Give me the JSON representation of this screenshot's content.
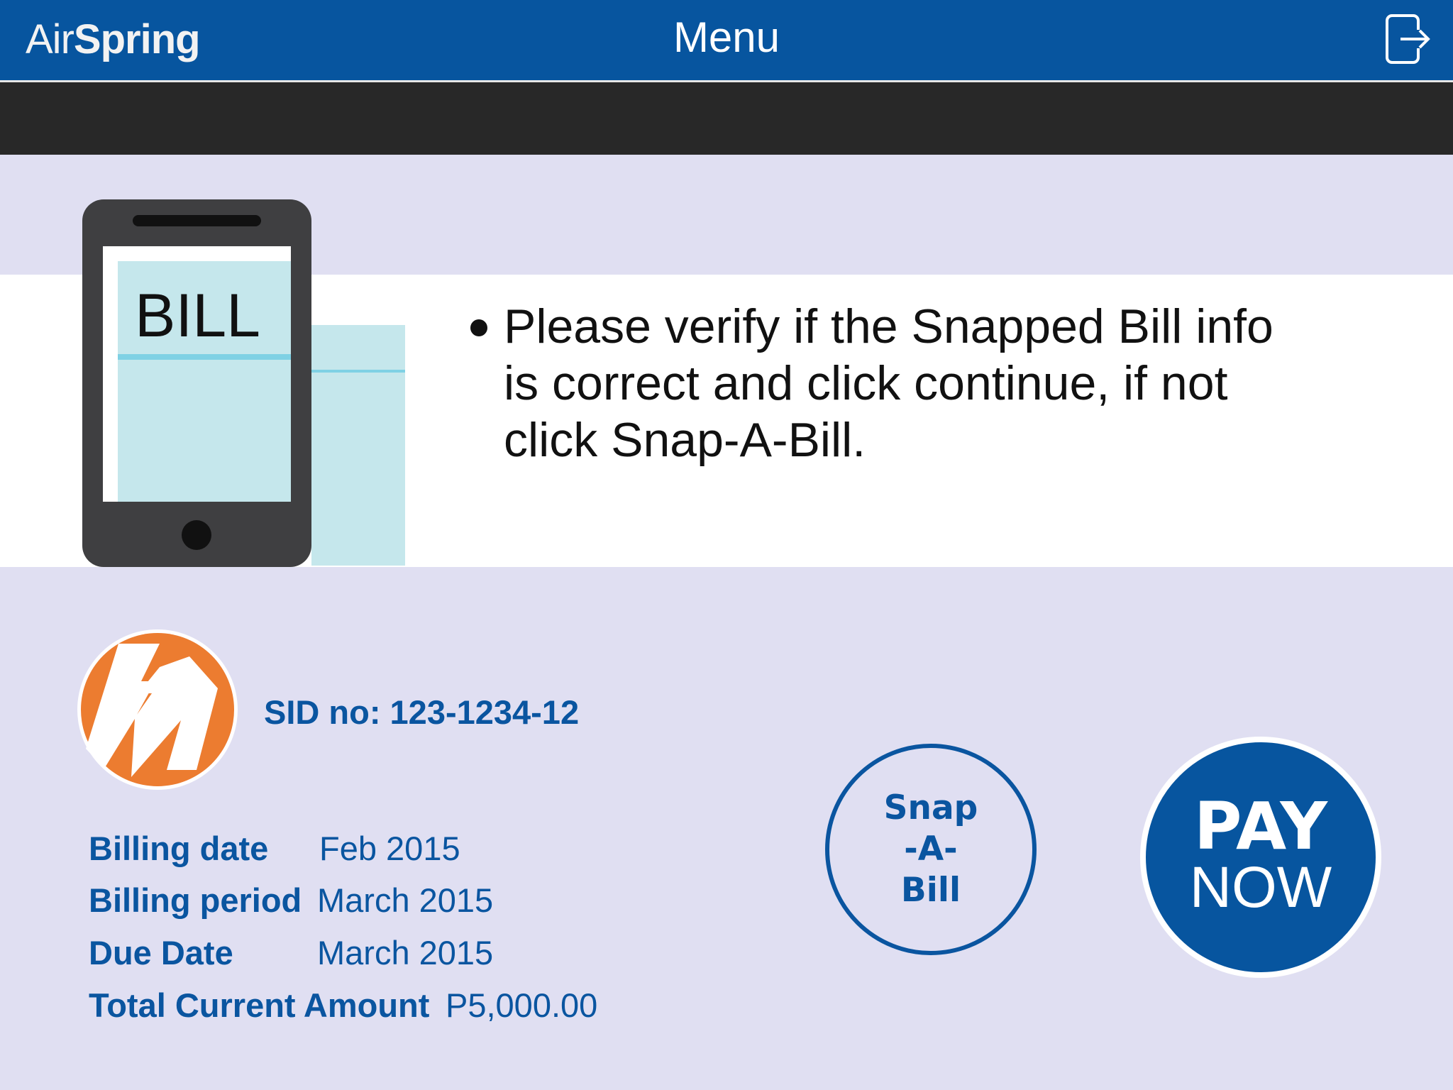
{
  "header": {
    "brand_light": "Air",
    "brand_bold": "Spring",
    "title": "Menu",
    "logout_icon": "logout-icon"
  },
  "illustration": {
    "phone_screen_text": "BILL"
  },
  "instruction": "Please verify if the Snapped Bill info is correct and click continue, if not click Snap-A-Bill.",
  "account": {
    "sid": "SID no: 123-1234-12"
  },
  "billing": [
    {
      "label": "Billing date",
      "value": "Feb 2015"
    },
    {
      "label": "Billing period",
      "value": "March 2015"
    },
    {
      "label": "Due Date",
      "value": "March 2015"
    },
    {
      "label": "Total Current Amount",
      "value": "P5,000.00"
    }
  ],
  "actions": {
    "snap_lines": [
      "Snap",
      "-A-",
      "Bill"
    ],
    "pay_lines": [
      "PAY",
      "NOW"
    ]
  },
  "colors": {
    "primary": "#07559f",
    "background": "#e0dff2",
    "logo": "#ec7c30"
  }
}
